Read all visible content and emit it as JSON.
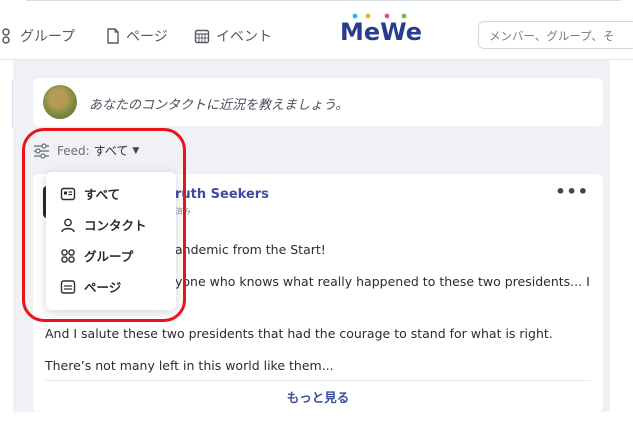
{
  "nav": {
    "groups_label": "グループ",
    "pages_label": "ページ",
    "events_label": "イベント",
    "search_placeholder": "メンバー、グループ、そ"
  },
  "brand": {
    "logo_text": "MeWe"
  },
  "composer": {
    "prompt": "あなたのコンタクトに近況を教えましょう。"
  },
  "feed_filter": {
    "label": "Feed:",
    "value": "すべて"
  },
  "dropdown": {
    "items": [
      {
        "label": "すべて",
        "icon": "all-icon"
      },
      {
        "label": "コンタクト",
        "icon": "contact-icon"
      },
      {
        "label": "グループ",
        "icon": "group-icon"
      },
      {
        "label": "ページ",
        "icon": "page-icon"
      }
    ]
  },
  "post": {
    "group_name_partial": "ruth Seekers",
    "sub_partial": "済み",
    "lines": [
      "andemic from the Start!",
      "yone who knows what really happened to these two presidents... I",
      "And I salute these two presidents that had the courage to stand for what is right.",
      "There’s not many left in this world like them..."
    ],
    "see_more": "もっと見る"
  },
  "colors": {
    "accent": "#3d4d9d",
    "highlight": "#e8141a"
  }
}
